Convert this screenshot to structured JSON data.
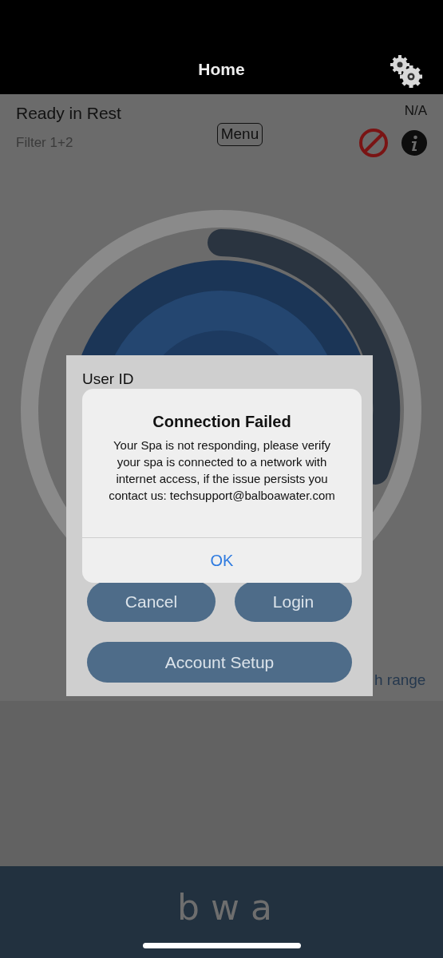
{
  "header": {
    "title": "Home"
  },
  "status": {
    "mode": "Ready in Rest",
    "filter": "Filter 1+2",
    "menu": "Menu",
    "temperature": "N/A"
  },
  "login": {
    "user_id_label": "User ID",
    "behind_text": "h range",
    "buttons": [
      {
        "label": "Cancel"
      },
      {
        "label": "Login"
      },
      {
        "label": "Account Setup"
      }
    ]
  },
  "alert": {
    "title": "Connection Failed",
    "message": "Your Spa is not responding, please verify your spa is connected to a network with internet access, if the issue persists you contact us: techsupport@balboawater.com",
    "button": "OK"
  },
  "footer": {
    "logo": "bwa"
  }
}
